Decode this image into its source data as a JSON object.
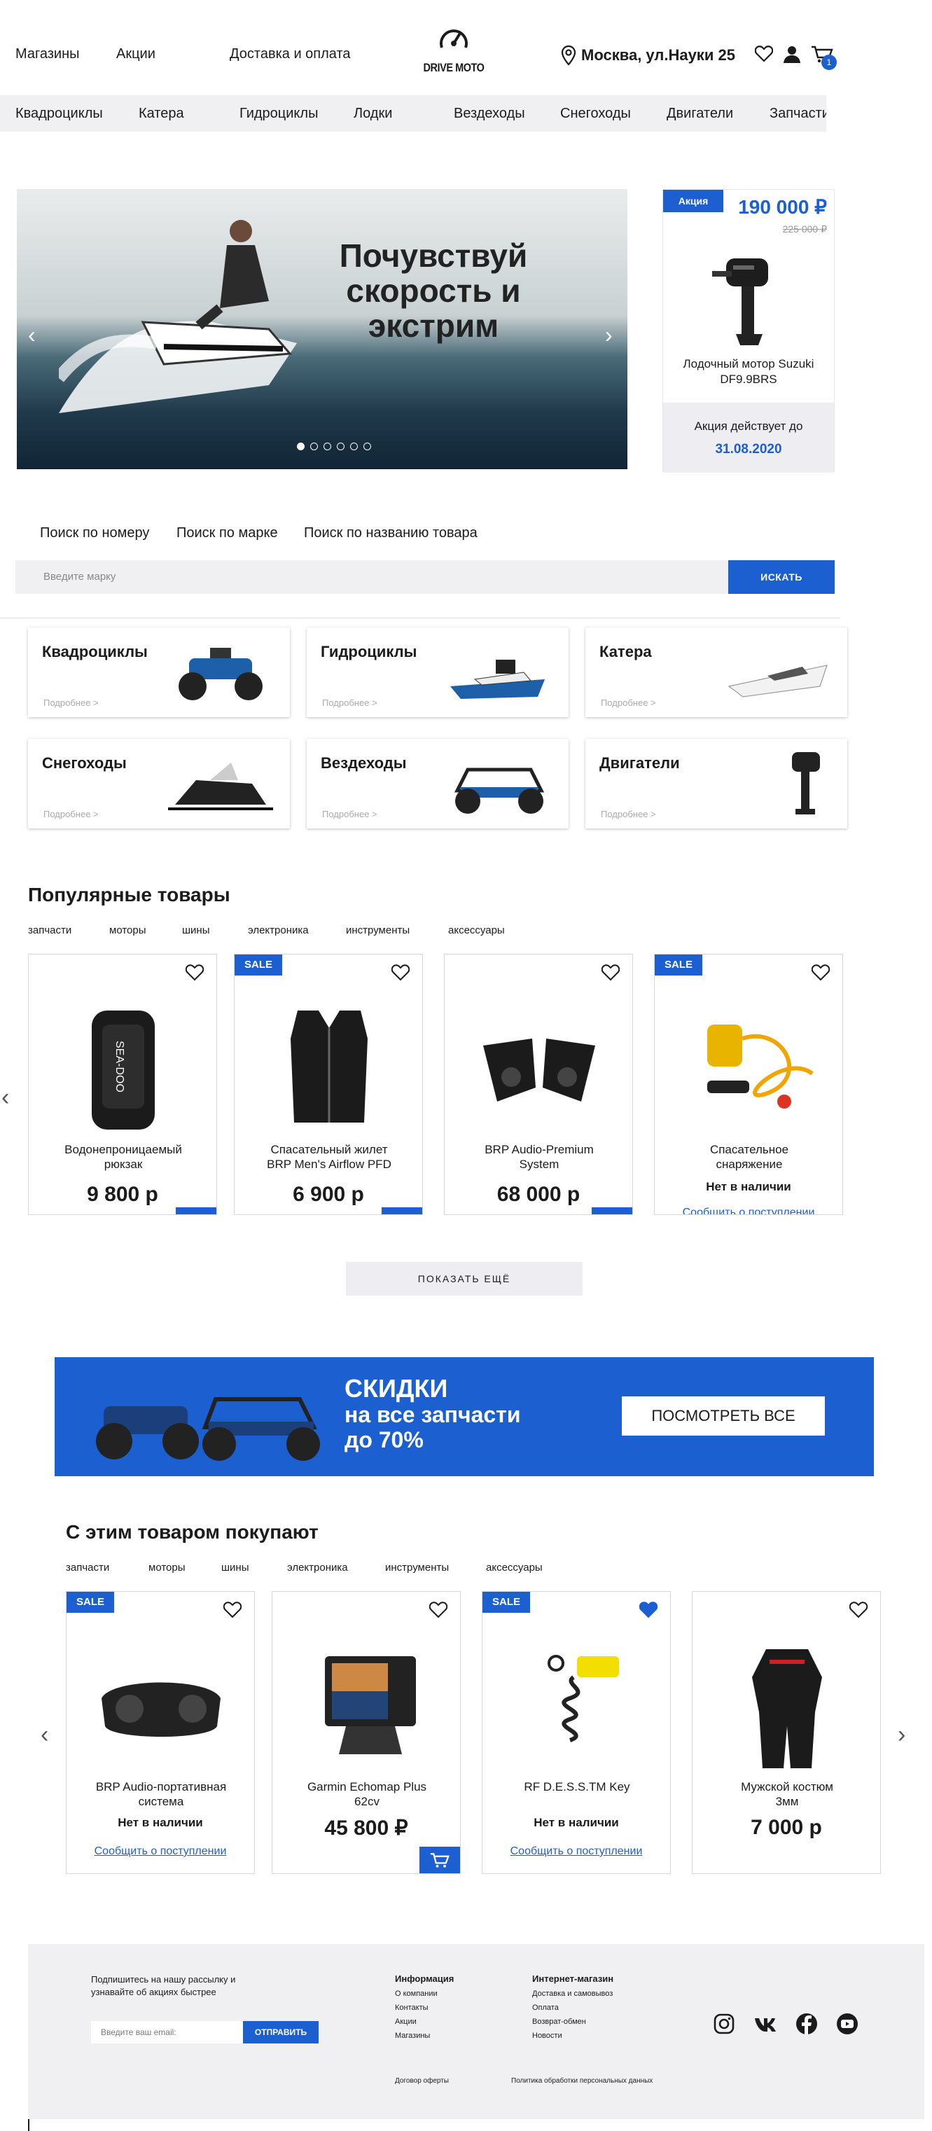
{
  "header": {
    "nav": [
      "Магазины",
      "Акции",
      "Доставка и оплата"
    ],
    "logo_text": "DRIVE MOTO",
    "address": "Москва, ул.Науки 25",
    "cart_count": "1"
  },
  "categories_bar": [
    "Квадроциклы",
    "Катера",
    "Гидроциклы",
    "Лодки",
    "Вездеходы",
    "Снегоходы",
    "Двигатели",
    "Запчасти"
  ],
  "hero": {
    "title_line1": "Почувствуй",
    "title_line2": "скорость и",
    "title_line3": "экстрим",
    "slides_count": 6,
    "active_slide": 1
  },
  "promo": {
    "tag": "Акция",
    "price": "190 000 ₽",
    "old_price": "225 000 ₽",
    "name": "Лодочный мотор Suzuki DF9.9BRS",
    "until_label": "Акция действует до",
    "until_date": "31.08.2020"
  },
  "search": {
    "tabs": [
      "Поиск по номеру",
      "Поиск по марке",
      "Поиск по названию товара"
    ],
    "placeholder": "Введите марку",
    "button": "ИСКАТЬ"
  },
  "category_cards": [
    {
      "name": "Квадроциклы",
      "more": "Подробнее >"
    },
    {
      "name": "Гидроциклы",
      "more": "Подробнее >"
    },
    {
      "name": "Катера",
      "more": "Подробнее >"
    },
    {
      "name": "Снегоходы",
      "more": "Подробнее >"
    },
    {
      "name": "Вездеходы",
      "more": "Подробнее >"
    },
    {
      "name": "Двигатели",
      "more": "Подробнее >"
    }
  ],
  "popular": {
    "title": "Популярные товары",
    "tabs": [
      "запчасти",
      "моторы",
      "шины",
      "электроника",
      "инструменты",
      "аксессуары"
    ],
    "items": [
      {
        "name1": "Водонепроницаемый",
        "name2": "рюкзак",
        "price": "9 800 р",
        "sale": false
      },
      {
        "name1": "Спасательный жилет",
        "name2": "BRP Men's Airflow PFD",
        "price": "6 900 р",
        "sale": true
      },
      {
        "name1": "BRP Audio-Premium",
        "name2": "System",
        "price": "68 000 р",
        "sale": false
      },
      {
        "name1": "Спасательное",
        "name2": "снаряжение",
        "status": "Нет в наличии",
        "notify": "Сообщить о поступлении",
        "sale": true
      }
    ],
    "sale_label": "SALE",
    "show_more": "ПОКАЗАТЬ ЕЩЁ"
  },
  "banner": {
    "line1": "СКИДКИ",
    "line2": "на все запчасти",
    "line3": "до 70%",
    "button": "ПОСМОТРЕТЬ ВСЕ"
  },
  "bought_with": {
    "title": "С этим товаром покупают",
    "tabs": [
      "запчасти",
      "моторы",
      "шины",
      "электроника",
      "инструменты",
      "аксессуары"
    ],
    "items": [
      {
        "name1": "BRP Audio-портативная",
        "name2": "система",
        "status": "Нет в наличии",
        "notify": "Сообщить о поступлении",
        "sale": true
      },
      {
        "name1": "Garmin Echomap Plus",
        "name2": "62cv",
        "price": "45 800 ₽",
        "sale": false
      },
      {
        "name1": "RF D.E.S.S.TM Key",
        "name2": "",
        "status": "Нет в наличии",
        "notify": "Сообщить о поступлении",
        "sale": true
      },
      {
        "name1": "Мужской костюм",
        "name2": "3мм",
        "price": "7 000 р",
        "sale": false
      }
    ]
  },
  "footer": {
    "subscribe1": "Подпишитесь на нашу рассылку и",
    "subscribe2": "узнавайте об акциях быстрее",
    "email_placeholder": "Введите ваш email:",
    "send": "ОТПРАВИТЬ",
    "info_title": "Информация",
    "info_items": [
      "О компании",
      "Контакты",
      "Акции",
      "Магазины"
    ],
    "shop_title": "Интернет-магазин",
    "shop_items": [
      "Доставка и самовывоз",
      "Оплата",
      "Возврат-обмен",
      "Новости"
    ],
    "offer": "Договор оферты",
    "privacy": "Политика обработки персональных данных"
  },
  "colors": {
    "accent": "#1c5fd0",
    "bar": "#f0f0f3"
  }
}
